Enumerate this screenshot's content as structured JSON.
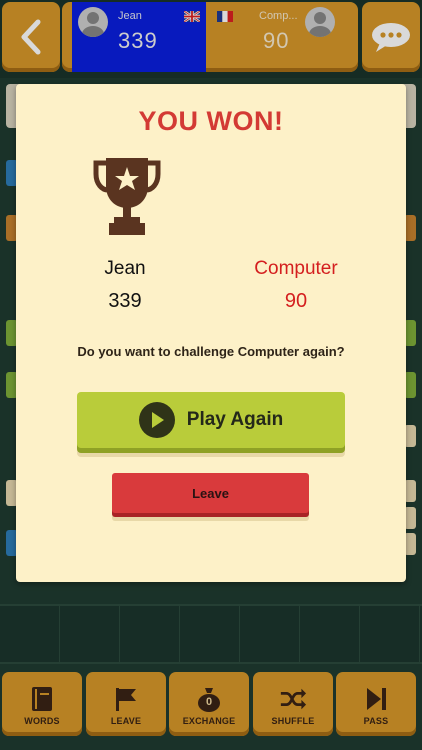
{
  "header": {
    "player1": {
      "name": "Jean",
      "score": "339",
      "flag": "uk-flag"
    },
    "player2": {
      "name": "Comp...",
      "score": "90",
      "flag": "france-flag"
    }
  },
  "modal": {
    "title": "YOU WON!",
    "winner": {
      "name": "Jean",
      "score": "339"
    },
    "loser": {
      "name": "Computer",
      "score": "90"
    },
    "question": "Do you want to challenge Computer again?",
    "play_again_label": "Play Again",
    "leave_label": "Leave"
  },
  "toolbar": {
    "items": [
      {
        "label": "WORDS",
        "icon": "book-icon"
      },
      {
        "label": "LEAVE",
        "icon": "flag-icon"
      },
      {
        "label": "EXCHANGE",
        "icon": "money-bag-icon",
        "badge": "0"
      },
      {
        "label": "SHUFFLE",
        "icon": "shuffle-icon"
      },
      {
        "label": "PASS",
        "icon": "skip-icon"
      }
    ]
  },
  "colors": {
    "accent_orange": "#d7982a",
    "player_blue": "#0a1fe0",
    "title_red": "#d33a34",
    "play_green": "#b9cc3a",
    "leave_red": "#d93a3c",
    "modal_bg": "#fdf1c8"
  }
}
